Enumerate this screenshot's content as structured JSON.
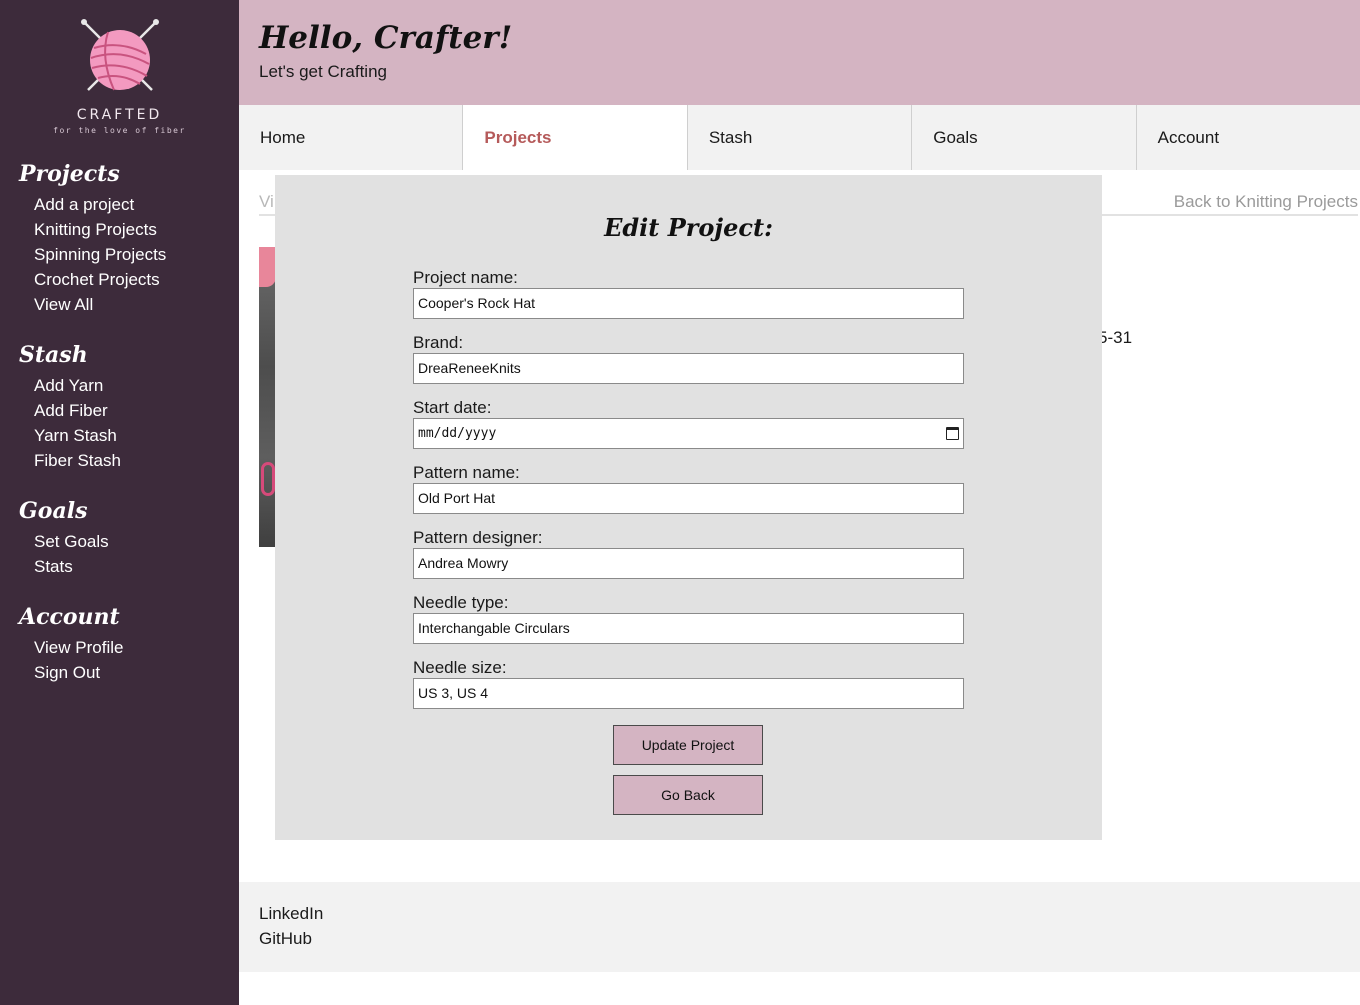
{
  "logo": {
    "word": "CRAFTED",
    "tagline": "for the love of fiber"
  },
  "sidebar": {
    "sections": [
      {
        "heading": "Projects",
        "links": [
          "Add a project",
          "Knitting Projects",
          "Spinning Projects",
          "Crochet Projects",
          "View All"
        ]
      },
      {
        "heading": "Stash",
        "links": [
          "Add Yarn",
          "Add Fiber",
          "Yarn Stash",
          "Fiber Stash"
        ]
      },
      {
        "heading": "Goals",
        "links": [
          "Set Goals",
          "Stats"
        ]
      },
      {
        "heading": "Account",
        "links": [
          "View Profile",
          "Sign Out"
        ]
      }
    ]
  },
  "header": {
    "title": "Hello, Crafter!",
    "subtitle": "Let's get Crafting"
  },
  "nav": {
    "tabs": [
      "Home",
      "Projects",
      "Stash",
      "Goals",
      "Account"
    ],
    "active": "Projects"
  },
  "background": {
    "view_fragment": "Vi",
    "back_link": "Back to Knitting Projects",
    "date_fragment": "5-31"
  },
  "modal": {
    "title": "Edit Project:",
    "fields": [
      {
        "label": "Project name:",
        "value": "Cooper's Rock Hat"
      },
      {
        "label": "Brand:",
        "value": "DreaReneeKnits"
      },
      {
        "label": "Start date:",
        "value": "mm/dd/yyyy"
      },
      {
        "label": "Pattern name:",
        "value": "Old Port Hat"
      },
      {
        "label": "Pattern designer:",
        "value": "Andrea Mowry"
      },
      {
        "label": "Needle type:",
        "value": "Interchangable Circulars"
      },
      {
        "label": "Needle size:",
        "value": "US 3, US 4"
      }
    ],
    "update_button": "Update Project",
    "back_button": "Go Back"
  },
  "footer": {
    "links": [
      "LinkedIn",
      "GitHub"
    ]
  },
  "colors": {
    "sidebar": "#3d2b3b",
    "header": "#d4b4c2",
    "accent": "#b55a5a",
    "modal": "#e1e1e1"
  }
}
